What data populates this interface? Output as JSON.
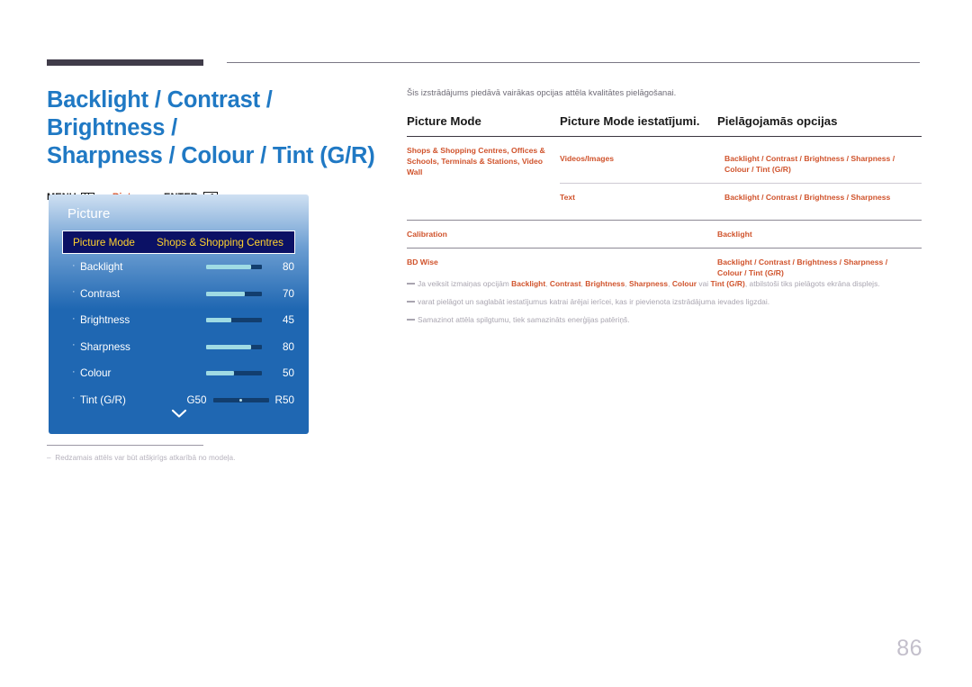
{
  "page": {
    "number": "86"
  },
  "left": {
    "title": "Backlight / Contrast / Brightness /\nSharpness / Colour / Tint (G/R)",
    "menu_path": {
      "menu_label": "MENU",
      "arrow1": "→",
      "picture_label": "Picture",
      "arrow2": "→",
      "enter_label": "ENTER",
      "enter_glyph": "⏎"
    },
    "osd": {
      "title": "Picture",
      "selected": {
        "label": "Picture Mode",
        "value": "Shops & Shopping Centres"
      },
      "rows": [
        {
          "bullet": "·",
          "label": "Backlight",
          "value": "80",
          "fill_pct": 80
        },
        {
          "bullet": "·",
          "label": "Contrast",
          "value": "70",
          "fill_pct": 70
        },
        {
          "bullet": "·",
          "label": "Brightness",
          "value": "45",
          "fill_pct": 45
        },
        {
          "bullet": "·",
          "label": "Sharpness",
          "value": "80",
          "fill_pct": 80
        },
        {
          "bullet": "·",
          "label": "Colour",
          "value": "50",
          "fill_pct": 50
        }
      ],
      "tint_row": {
        "bullet": "·",
        "label": "Tint (G/R)",
        "left_value": "G50",
        "right_value": "R50"
      },
      "scroll_icon": "chevron-down-icon"
    },
    "footnote": "Redzamais attēls var būt atšķirīgs atkarībā no modeļa."
  },
  "right": {
    "intro": "Šis izstrādājums piedāvā vairākas opcijas attēla kvalitātes pielāgošanai.",
    "table": {
      "headers": [
        "Picture Mode",
        "Picture Mode iestatījumi.",
        "Pielāgojamās opcijas"
      ],
      "rows": [
        {
          "mode": "Shops & Shopping Centres, Offices & Schools,  Terminals & Stations, Video Wall",
          "subrows": [
            {
              "setting": "Videos/Images",
              "options": "Backlight / Contrast / Brightness / Sharpness / Colour / Tint (G/R)"
            },
            {
              "setting": "Text",
              "options": "Backlight / Contrast / Brightness / Sharpness"
            }
          ]
        },
        {
          "mode": "Calibration",
          "subrows": [
            {
              "setting": "",
              "options": "Backlight"
            }
          ]
        },
        {
          "mode": "BD Wise",
          "subrows": [
            {
              "setting": "",
              "options": "Backlight / Contrast / Brightness / Sharpness / Colour / Tint (G/R)"
            }
          ]
        }
      ]
    },
    "notes": [
      {
        "parts": [
          {
            "t": "Ja veiksit izmaiņas opcijām ",
            "b": false
          },
          {
            "t": "Backlight",
            "b": true
          },
          {
            "t": ", ",
            "b": false
          },
          {
            "t": "Contrast",
            "b": true
          },
          {
            "t": ", ",
            "b": false
          },
          {
            "t": "Brightness",
            "b": true
          },
          {
            "t": ", ",
            "b": false
          },
          {
            "t": "Sharpness",
            "b": true
          },
          {
            "t": ", ",
            "b": false
          },
          {
            "t": "Colour",
            "b": true
          },
          {
            "t": " vai ",
            "b": false
          },
          {
            "t": "Tint (G/R)",
            "b": true
          },
          {
            "t": ", atbilstoši tiks pielāgots ekrāna displejs.",
            "b": false
          }
        ]
      },
      {
        "parts": [
          {
            "t": "varat pielāgot un saglabāt iestatījumus katrai ārējai ierīcei, kas ir pievienota izstrādājuma ievades ligzdai.",
            "b": false
          }
        ]
      },
      {
        "parts": [
          {
            "t": "Samazinot attēla spilgtumu, tiek samazināts enerģijas patēriņš.",
            "b": false
          }
        ]
      }
    ]
  },
  "colors": {
    "title_blue": "#2079c4",
    "accent_orange": "#d0532c",
    "osd_blue": "#1f67b2",
    "osd_selected_bg": "#0b1165",
    "osd_selected_text": "#ffd22e",
    "slider_fill": "#9fdbe4",
    "slider_track": "#123e6e"
  }
}
